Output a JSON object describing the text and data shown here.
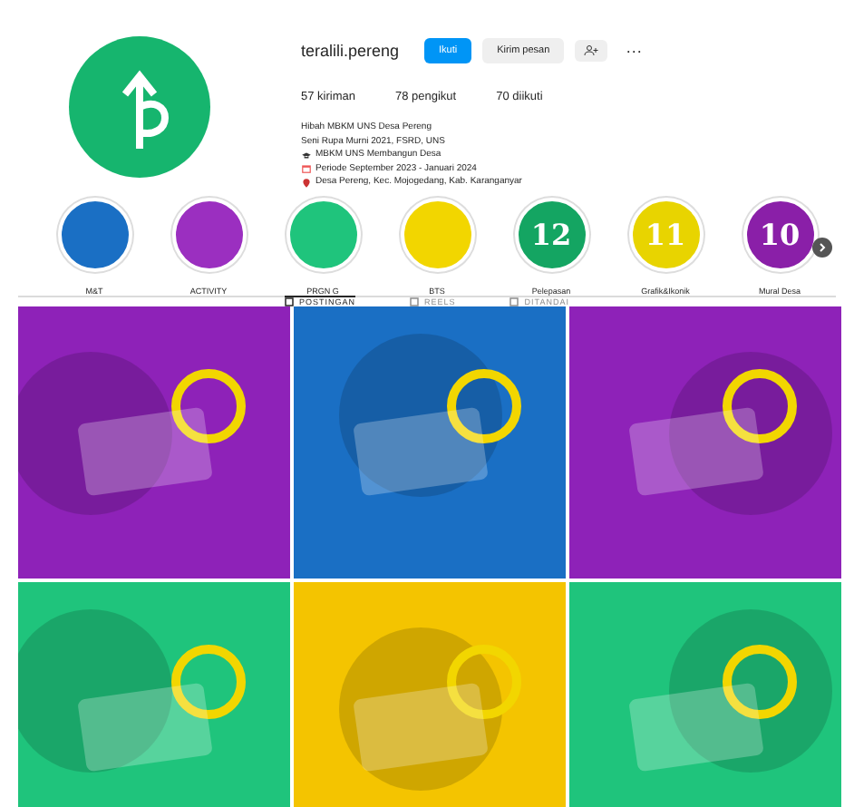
{
  "profile": {
    "username": "teralili.pereng",
    "buttons": [
      {
        "label": "Ikuti",
        "kind": "primary"
      },
      {
        "label": "Kirim pesan",
        "kind": "secondary"
      }
    ],
    "more": "···",
    "stats": [
      "57 kiriman",
      "78 pengikut",
      "70 diikuti"
    ],
    "bio": [
      "Hibah MBKM UNS Desa Pereng",
      "Seni Rupa Murni 2021, FSRD, UNS",
      "MBKM UNS Membangun Desa",
      "Periode September 2023 - Januari 2024",
      "Desa Pereng, Kec. Mojogedang, Kab. Karanganyar"
    ]
  },
  "highlights": [
    {
      "label": "M&T",
      "color": "#1a6fc4"
    },
    {
      "label": "ACTIVITY",
      "color": "#9b2fc0"
    },
    {
      "label": "PRGN G",
      "color": "#1fc47c"
    },
    {
      "label": "BTS",
      "color": "#f2d600"
    },
    {
      "label": "Pelepasan",
      "color": "#14a562",
      "cover_text": "12"
    },
    {
      "label": "Grafik&Ikonik",
      "color": "#e8d400",
      "cover_text": "11"
    },
    {
      "label": "Mural Desa",
      "color": "#8a1fa8",
      "cover_text": "10"
    }
  ],
  "tabs": [
    {
      "label": "POSTINGAN",
      "selected": true
    },
    {
      "label": "REELS",
      "selected": false
    },
    {
      "label": "DITANDAI",
      "selected": false
    }
  ],
  "posts": [
    {
      "color": "#8e22b8"
    },
    {
      "color": "#1a6fc4"
    },
    {
      "color": "#8e22b8"
    },
    {
      "color": "#1fc47c"
    },
    {
      "color": "#f4c400"
    },
    {
      "color": "#1fc47c"
    }
  ]
}
